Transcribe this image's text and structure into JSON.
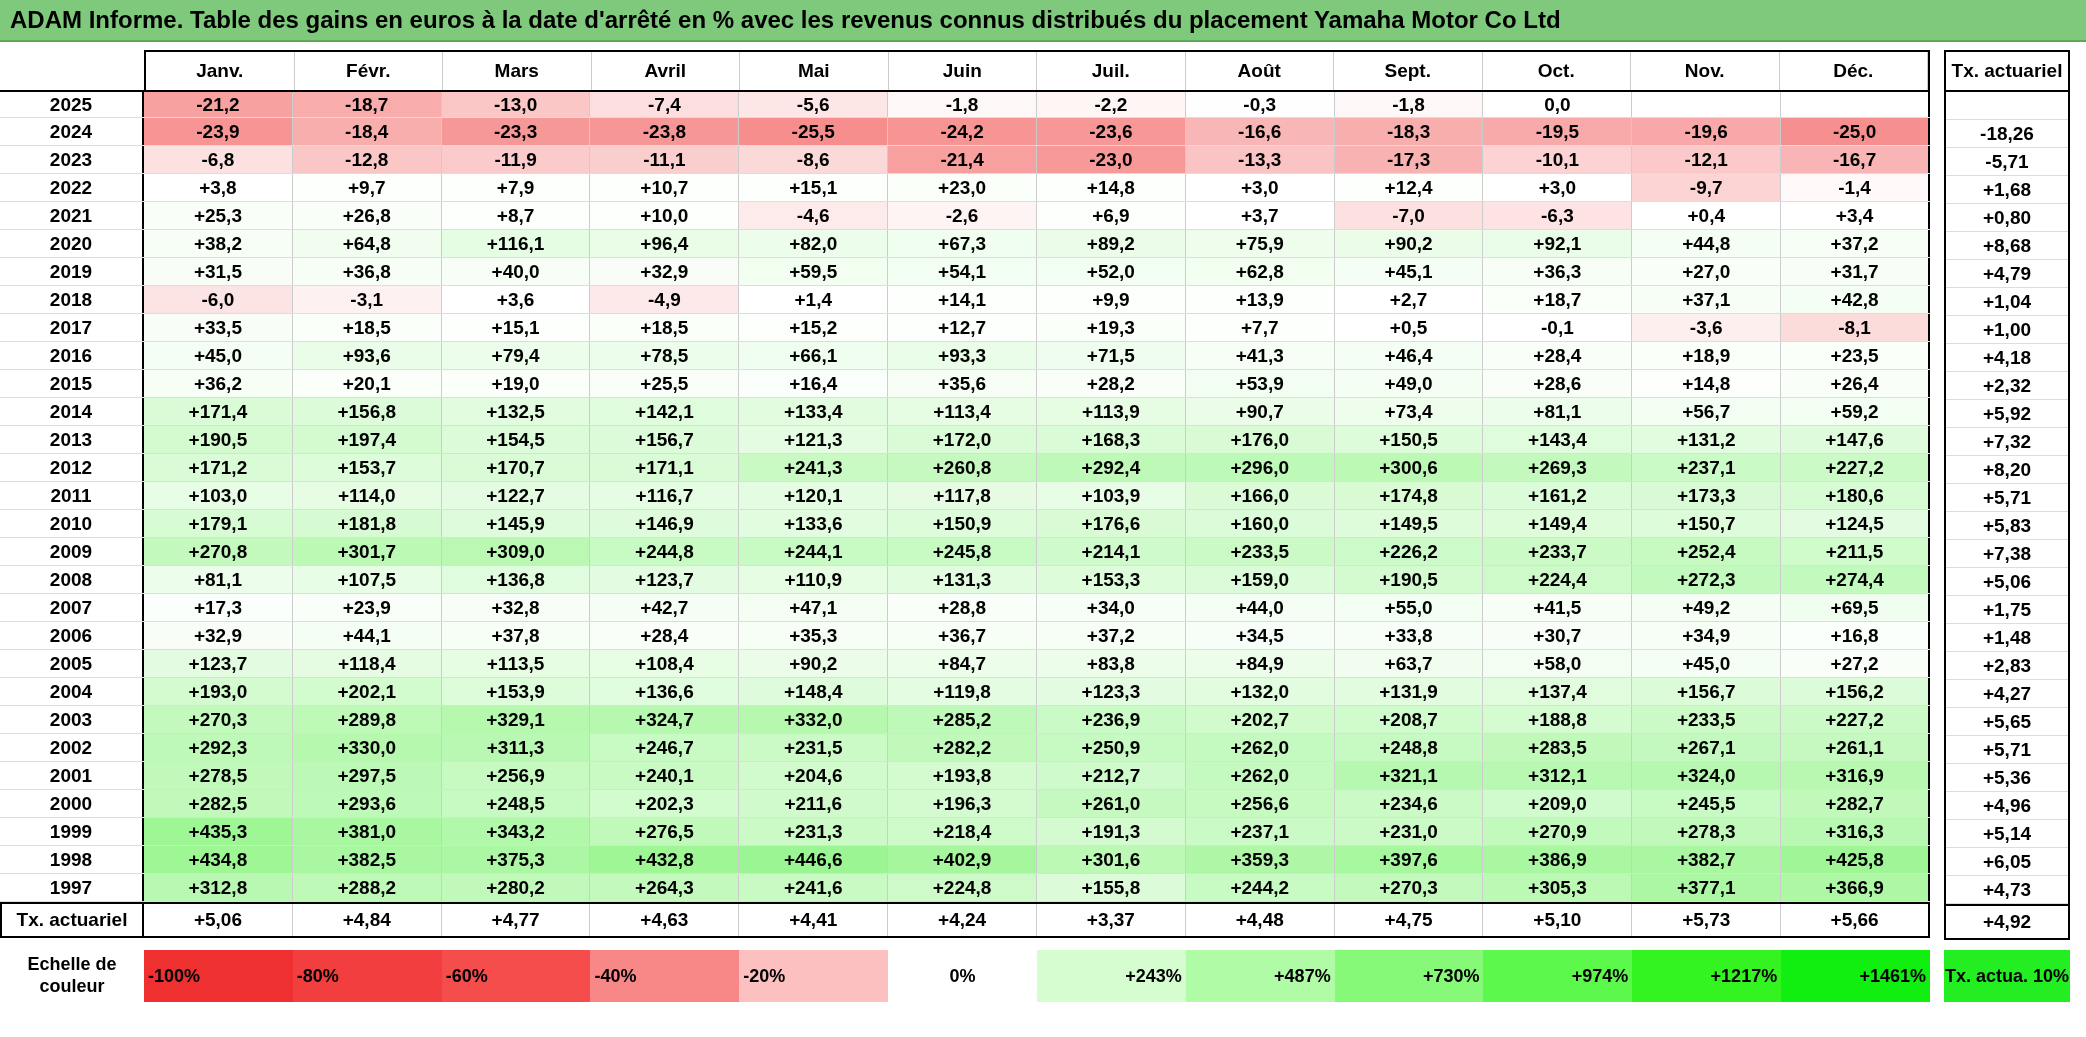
{
  "title": "ADAM Informe. Table des gains en euros à la date d'arrêté en % avec les revenus connus distribués du placement Yamaha Motor Co Ltd",
  "columns": [
    "Janv.",
    "Févr.",
    "Mars",
    "Avril",
    "Mai",
    "Juin",
    "Juil.",
    "Août",
    "Sept.",
    "Oct.",
    "Nov.",
    "Déc."
  ],
  "tx_header": "Tx. actuariel",
  "rows": [
    {
      "year": "2025",
      "cells": [
        "-21,2",
        "-18,7",
        "-13,0",
        "-7,4",
        "-5,6",
        "-1,8",
        "-2,2",
        "-0,3",
        "-1,8",
        "0,0"
      ]
    },
    {
      "year": "2024",
      "cells": [
        "-23,9",
        "-18,4",
        "-23,3",
        "-23,8",
        "-25,5",
        "-24,2",
        "-23,6",
        "-16,6",
        "-18,3",
        "-19,5",
        "-19,6",
        "-25,0"
      ],
      "tx": "-18,26"
    },
    {
      "year": "2023",
      "cells": [
        "-6,8",
        "-12,8",
        "-11,9",
        "-11,1",
        "-8,6",
        "-21,4",
        "-23,0",
        "-13,3",
        "-17,3",
        "-10,1",
        "-12,1",
        "-16,7"
      ],
      "tx": "-5,71"
    },
    {
      "year": "2022",
      "cells": [
        "+3,8",
        "+9,7",
        "+7,9",
        "+10,7",
        "+15,1",
        "+23,0",
        "+14,8",
        "+3,0",
        "+12,4",
        "+3,0",
        "-9,7",
        "-1,4"
      ],
      "tx": "+1,68"
    },
    {
      "year": "2021",
      "cells": [
        "+25,3",
        "+26,8",
        "+8,7",
        "+10,0",
        "-4,6",
        "-2,6",
        "+6,9",
        "+3,7",
        "-7,0",
        "-6,3",
        "+0,4",
        "+3,4"
      ],
      "tx": "+0,80"
    },
    {
      "year": "2020",
      "cells": [
        "+38,2",
        "+64,8",
        "+116,1",
        "+96,4",
        "+82,0",
        "+67,3",
        "+89,2",
        "+75,9",
        "+90,2",
        "+92,1",
        "+44,8",
        "+37,2"
      ],
      "tx": "+8,68"
    },
    {
      "year": "2019",
      "cells": [
        "+31,5",
        "+36,8",
        "+40,0",
        "+32,9",
        "+59,5",
        "+54,1",
        "+52,0",
        "+62,8",
        "+45,1",
        "+36,3",
        "+27,0",
        "+31,7"
      ],
      "tx": "+4,79"
    },
    {
      "year": "2018",
      "cells": [
        "-6,0",
        "-3,1",
        "+3,6",
        "-4,9",
        "+1,4",
        "+14,1",
        "+9,9",
        "+13,9",
        "+2,7",
        "+18,7",
        "+37,1",
        "+42,8"
      ],
      "tx": "+1,04"
    },
    {
      "year": "2017",
      "cells": [
        "+33,5",
        "+18,5",
        "+15,1",
        "+18,5",
        "+15,2",
        "+12,7",
        "+19,3",
        "+7,7",
        "+0,5",
        "-0,1",
        "-3,6",
        "-8,1"
      ],
      "tx": "+1,00"
    },
    {
      "year": "2016",
      "cells": [
        "+45,0",
        "+93,6",
        "+79,4",
        "+78,5",
        "+66,1",
        "+93,3",
        "+71,5",
        "+41,3",
        "+46,4",
        "+28,4",
        "+18,9",
        "+23,5"
      ],
      "tx": "+4,18"
    },
    {
      "year": "2015",
      "cells": [
        "+36,2",
        "+20,1",
        "+19,0",
        "+25,5",
        "+16,4",
        "+35,6",
        "+28,2",
        "+53,9",
        "+49,0",
        "+28,6",
        "+14,8",
        "+26,4"
      ],
      "tx": "+2,32"
    },
    {
      "year": "2014",
      "cells": [
        "+171,4",
        "+156,8",
        "+132,5",
        "+142,1",
        "+133,4",
        "+113,4",
        "+113,9",
        "+90,7",
        "+73,4",
        "+81,1",
        "+56,7",
        "+59,2"
      ],
      "tx": "+5,92"
    },
    {
      "year": "2013",
      "cells": [
        "+190,5",
        "+197,4",
        "+154,5",
        "+156,7",
        "+121,3",
        "+172,0",
        "+168,3",
        "+176,0",
        "+150,5",
        "+143,4",
        "+131,2",
        "+147,6"
      ],
      "tx": "+7,32"
    },
    {
      "year": "2012",
      "cells": [
        "+171,2",
        "+153,7",
        "+170,7",
        "+171,1",
        "+241,3",
        "+260,8",
        "+292,4",
        "+296,0",
        "+300,6",
        "+269,3",
        "+237,1",
        "+227,2"
      ],
      "tx": "+8,20"
    },
    {
      "year": "2011",
      "cells": [
        "+103,0",
        "+114,0",
        "+122,7",
        "+116,7",
        "+120,1",
        "+117,8",
        "+103,9",
        "+166,0",
        "+174,8",
        "+161,2",
        "+173,3",
        "+180,6"
      ],
      "tx": "+5,71"
    },
    {
      "year": "2010",
      "cells": [
        "+179,1",
        "+181,8",
        "+145,9",
        "+146,9",
        "+133,6",
        "+150,9",
        "+176,6",
        "+160,0",
        "+149,5",
        "+149,4",
        "+150,7",
        "+124,5"
      ],
      "tx": "+5,83"
    },
    {
      "year": "2009",
      "cells": [
        "+270,8",
        "+301,7",
        "+309,0",
        "+244,8",
        "+244,1",
        "+245,8",
        "+214,1",
        "+233,5",
        "+226,2",
        "+233,7",
        "+252,4",
        "+211,5"
      ],
      "tx": "+7,38"
    },
    {
      "year": "2008",
      "cells": [
        "+81,1",
        "+107,5",
        "+136,8",
        "+123,7",
        "+110,9",
        "+131,3",
        "+153,3",
        "+159,0",
        "+190,5",
        "+224,4",
        "+272,3",
        "+274,4"
      ],
      "tx": "+5,06"
    },
    {
      "year": "2007",
      "cells": [
        "+17,3",
        "+23,9",
        "+32,8",
        "+42,7",
        "+47,1",
        "+28,8",
        "+34,0",
        "+44,0",
        "+55,0",
        "+41,5",
        "+49,2",
        "+69,5"
      ],
      "tx": "+1,75"
    },
    {
      "year": "2006",
      "cells": [
        "+32,9",
        "+44,1",
        "+37,8",
        "+28,4",
        "+35,3",
        "+36,7",
        "+37,2",
        "+34,5",
        "+33,8",
        "+30,7",
        "+34,9",
        "+16,8"
      ],
      "tx": "+1,48"
    },
    {
      "year": "2005",
      "cells": [
        "+123,7",
        "+118,4",
        "+113,5",
        "+108,4",
        "+90,2",
        "+84,7",
        "+83,8",
        "+84,9",
        "+63,7",
        "+58,0",
        "+45,0",
        "+27,2"
      ],
      "tx": "+2,83"
    },
    {
      "year": "2004",
      "cells": [
        "+193,0",
        "+202,1",
        "+153,9",
        "+136,6",
        "+148,4",
        "+119,8",
        "+123,3",
        "+132,0",
        "+131,9",
        "+137,4",
        "+156,7",
        "+156,2"
      ],
      "tx": "+4,27"
    },
    {
      "year": "2003",
      "cells": [
        "+270,3",
        "+289,8",
        "+329,1",
        "+324,7",
        "+332,0",
        "+285,2",
        "+236,9",
        "+202,7",
        "+208,7",
        "+188,8",
        "+233,5",
        "+227,2"
      ],
      "tx": "+5,65"
    },
    {
      "year": "2002",
      "cells": [
        "+292,3",
        "+330,0",
        "+311,3",
        "+246,7",
        "+231,5",
        "+282,2",
        "+250,9",
        "+262,0",
        "+248,8",
        "+283,5",
        "+267,1",
        "+261,1"
      ],
      "tx": "+5,71"
    },
    {
      "year": "2001",
      "cells": [
        "+278,5",
        "+297,5",
        "+256,9",
        "+240,1",
        "+204,6",
        "+193,8",
        "+212,7",
        "+262,0",
        "+321,1",
        "+312,1",
        "+324,0",
        "+316,9"
      ],
      "tx": "+5,36"
    },
    {
      "year": "2000",
      "cells": [
        "+282,5",
        "+293,6",
        "+248,5",
        "+202,3",
        "+211,6",
        "+196,3",
        "+261,0",
        "+256,6",
        "+234,6",
        "+209,0",
        "+245,5",
        "+282,7"
      ],
      "tx": "+4,96"
    },
    {
      "year": "1999",
      "cells": [
        "+435,3",
        "+381,0",
        "+343,2",
        "+276,5",
        "+231,3",
        "+218,4",
        "+191,3",
        "+237,1",
        "+231,0",
        "+270,9",
        "+278,3",
        "+316,3"
      ],
      "tx": "+5,14"
    },
    {
      "year": "1998",
      "cells": [
        "+434,8",
        "+382,5",
        "+375,3",
        "+432,8",
        "+446,6",
        "+402,9",
        "+301,6",
        "+359,3",
        "+397,6",
        "+386,9",
        "+382,7",
        "+425,8"
      ],
      "tx": "+6,05"
    },
    {
      "year": "1997",
      "cells": [
        "+312,8",
        "+288,2",
        "+280,2",
        "+264,3",
        "+241,6",
        "+224,8",
        "+155,8",
        "+244,2",
        "+270,3",
        "+305,3",
        "+377,1",
        "+366,9"
      ],
      "tx": "+4,73"
    }
  ],
  "summary": {
    "label": "Tx. actuariel",
    "cells": [
      "+5,06",
      "+4,84",
      "+4,77",
      "+4,63",
      "+4,41",
      "+4,24",
      "+3,37",
      "+4,48",
      "+4,75",
      "+5,10",
      "+5,73",
      "+5,66"
    ],
    "tx": "+4,92"
  },
  "legend": {
    "label": "Echelle de couleur",
    "items": [
      {
        "label": "-100%",
        "color": "#ef3030"
      },
      {
        "label": "-80%",
        "color": "#f23e3e"
      },
      {
        "label": "-60%",
        "color": "#f54c4c"
      },
      {
        "label": "-40%",
        "color": "#f88888"
      },
      {
        "label": "-20%",
        "color": "#fcc0c0"
      },
      {
        "label": "0%",
        "color": "#ffffff"
      },
      {
        "label": "+243%",
        "color": "#d6fdd0"
      },
      {
        "label": "+487%",
        "color": "#b0fba6"
      },
      {
        "label": "+730%",
        "color": "#86fa78"
      },
      {
        "label": "+974%",
        "color": "#5cf84c"
      },
      {
        "label": "+1217%",
        "color": "#33f320"
      },
      {
        "label": "+1461%",
        "color": "#10ef10"
      }
    ],
    "tx": {
      "label": "Tx. actua. 10%",
      "color": "#22ee22"
    }
  }
}
